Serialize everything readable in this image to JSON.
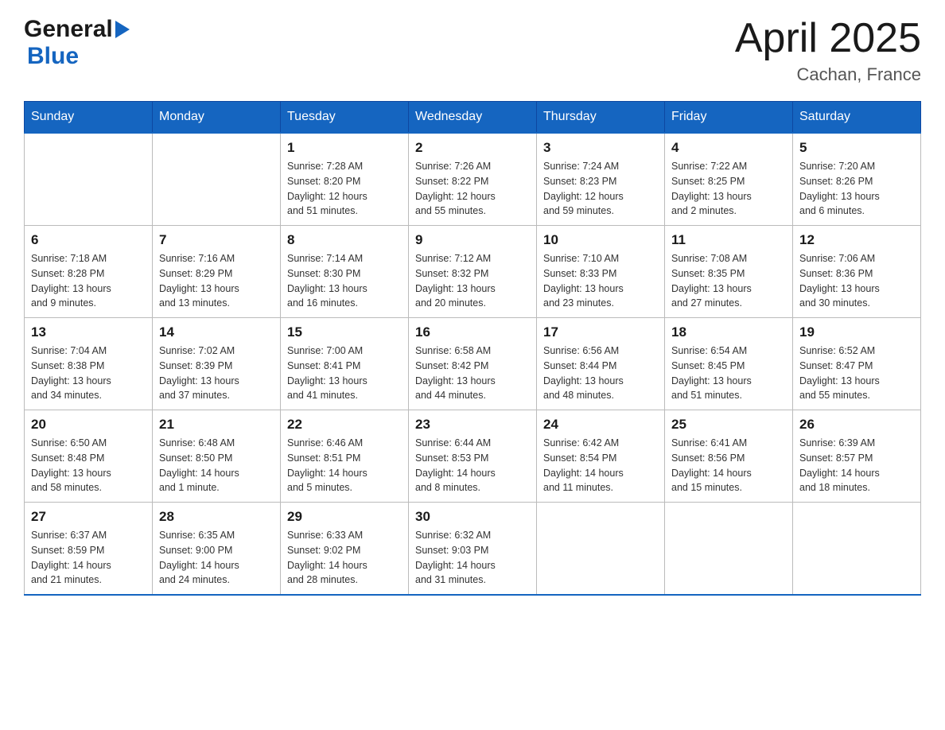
{
  "header": {
    "logo_general": "General",
    "logo_blue": "Blue",
    "title": "April 2025",
    "location": "Cachan, France"
  },
  "days_of_week": [
    "Sunday",
    "Monday",
    "Tuesday",
    "Wednesday",
    "Thursday",
    "Friday",
    "Saturday"
  ],
  "weeks": [
    [
      {
        "day": "",
        "info": ""
      },
      {
        "day": "",
        "info": ""
      },
      {
        "day": "1",
        "info": "Sunrise: 7:28 AM\nSunset: 8:20 PM\nDaylight: 12 hours\nand 51 minutes."
      },
      {
        "day": "2",
        "info": "Sunrise: 7:26 AM\nSunset: 8:22 PM\nDaylight: 12 hours\nand 55 minutes."
      },
      {
        "day": "3",
        "info": "Sunrise: 7:24 AM\nSunset: 8:23 PM\nDaylight: 12 hours\nand 59 minutes."
      },
      {
        "day": "4",
        "info": "Sunrise: 7:22 AM\nSunset: 8:25 PM\nDaylight: 13 hours\nand 2 minutes."
      },
      {
        "day": "5",
        "info": "Sunrise: 7:20 AM\nSunset: 8:26 PM\nDaylight: 13 hours\nand 6 minutes."
      }
    ],
    [
      {
        "day": "6",
        "info": "Sunrise: 7:18 AM\nSunset: 8:28 PM\nDaylight: 13 hours\nand 9 minutes."
      },
      {
        "day": "7",
        "info": "Sunrise: 7:16 AM\nSunset: 8:29 PM\nDaylight: 13 hours\nand 13 minutes."
      },
      {
        "day": "8",
        "info": "Sunrise: 7:14 AM\nSunset: 8:30 PM\nDaylight: 13 hours\nand 16 minutes."
      },
      {
        "day": "9",
        "info": "Sunrise: 7:12 AM\nSunset: 8:32 PM\nDaylight: 13 hours\nand 20 minutes."
      },
      {
        "day": "10",
        "info": "Sunrise: 7:10 AM\nSunset: 8:33 PM\nDaylight: 13 hours\nand 23 minutes."
      },
      {
        "day": "11",
        "info": "Sunrise: 7:08 AM\nSunset: 8:35 PM\nDaylight: 13 hours\nand 27 minutes."
      },
      {
        "day": "12",
        "info": "Sunrise: 7:06 AM\nSunset: 8:36 PM\nDaylight: 13 hours\nand 30 minutes."
      }
    ],
    [
      {
        "day": "13",
        "info": "Sunrise: 7:04 AM\nSunset: 8:38 PM\nDaylight: 13 hours\nand 34 minutes."
      },
      {
        "day": "14",
        "info": "Sunrise: 7:02 AM\nSunset: 8:39 PM\nDaylight: 13 hours\nand 37 minutes."
      },
      {
        "day": "15",
        "info": "Sunrise: 7:00 AM\nSunset: 8:41 PM\nDaylight: 13 hours\nand 41 minutes."
      },
      {
        "day": "16",
        "info": "Sunrise: 6:58 AM\nSunset: 8:42 PM\nDaylight: 13 hours\nand 44 minutes."
      },
      {
        "day": "17",
        "info": "Sunrise: 6:56 AM\nSunset: 8:44 PM\nDaylight: 13 hours\nand 48 minutes."
      },
      {
        "day": "18",
        "info": "Sunrise: 6:54 AM\nSunset: 8:45 PM\nDaylight: 13 hours\nand 51 minutes."
      },
      {
        "day": "19",
        "info": "Sunrise: 6:52 AM\nSunset: 8:47 PM\nDaylight: 13 hours\nand 55 minutes."
      }
    ],
    [
      {
        "day": "20",
        "info": "Sunrise: 6:50 AM\nSunset: 8:48 PM\nDaylight: 13 hours\nand 58 minutes."
      },
      {
        "day": "21",
        "info": "Sunrise: 6:48 AM\nSunset: 8:50 PM\nDaylight: 14 hours\nand 1 minute."
      },
      {
        "day": "22",
        "info": "Sunrise: 6:46 AM\nSunset: 8:51 PM\nDaylight: 14 hours\nand 5 minutes."
      },
      {
        "day": "23",
        "info": "Sunrise: 6:44 AM\nSunset: 8:53 PM\nDaylight: 14 hours\nand 8 minutes."
      },
      {
        "day": "24",
        "info": "Sunrise: 6:42 AM\nSunset: 8:54 PM\nDaylight: 14 hours\nand 11 minutes."
      },
      {
        "day": "25",
        "info": "Sunrise: 6:41 AM\nSunset: 8:56 PM\nDaylight: 14 hours\nand 15 minutes."
      },
      {
        "day": "26",
        "info": "Sunrise: 6:39 AM\nSunset: 8:57 PM\nDaylight: 14 hours\nand 18 minutes."
      }
    ],
    [
      {
        "day": "27",
        "info": "Sunrise: 6:37 AM\nSunset: 8:59 PM\nDaylight: 14 hours\nand 21 minutes."
      },
      {
        "day": "28",
        "info": "Sunrise: 6:35 AM\nSunset: 9:00 PM\nDaylight: 14 hours\nand 24 minutes."
      },
      {
        "day": "29",
        "info": "Sunrise: 6:33 AM\nSunset: 9:02 PM\nDaylight: 14 hours\nand 28 minutes."
      },
      {
        "day": "30",
        "info": "Sunrise: 6:32 AM\nSunset: 9:03 PM\nDaylight: 14 hours\nand 31 minutes."
      },
      {
        "day": "",
        "info": ""
      },
      {
        "day": "",
        "info": ""
      },
      {
        "day": "",
        "info": ""
      }
    ]
  ]
}
